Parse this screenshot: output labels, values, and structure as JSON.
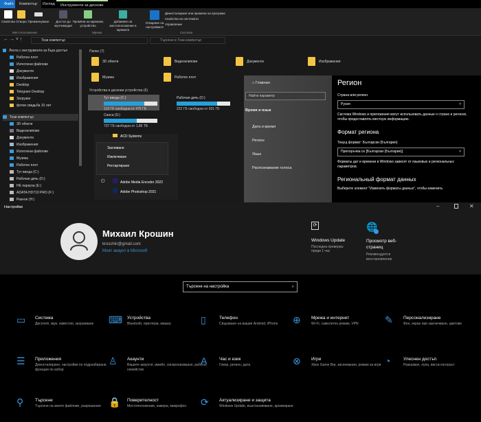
{
  "explorer": {
    "tabs": [
      "Файл",
      "Компютър",
      "Изглед",
      "Инструменти за дискове"
    ],
    "ribbon": {
      "buttons": [
        "Свойства",
        "Отвори",
        "Преименуване",
        "Достъп до мултимедия",
        "Промяна на мрежово устройство",
        "Добавяне на местоположение в мрежата",
        "Отваряне на настройките"
      ],
      "system_links": [
        "Деинсталиране или промяна на програма",
        "Свойства на системата",
        "Управление"
      ],
      "groups": [
        "Местоположение",
        "Мрежа",
        "Система"
      ]
    },
    "address": "Този компютър",
    "search_placeholder": "Търсене в Този компютър",
    "nav": {
      "quick_access": "Лента с инструменти за бърз достъп",
      "quick_items": [
        "Работен плот",
        "Изтеглени файлове",
        "Документи",
        "Изображения",
        "Desktop",
        "Telegram Desktop",
        "Загрузки",
        "фотки свадьба 10 лет"
      ],
      "this_pc": "Този компютър",
      "pc_items": [
        "3D обекти",
        "Видеоклипове",
        "Документи",
        "Изображения",
        "Изтеглени файлове",
        "Музика",
        "Работен плот",
        "Тут винда (C:)",
        "Рабочая дичь (D:)",
        "НЕ паркуха (E:)",
        "ADATA HD710 PRO (F:)",
        "Разное (H:)"
      ]
    },
    "folders_header": "Папки (7)",
    "folders": [
      "3D обекти",
      "Видеоклипове",
      "Документи",
      "Изображения",
      "Музика",
      "Работен плот"
    ],
    "drives_header": "Устройства и дискови устройства (6)",
    "drives": [
      {
        "name": "Тут винда (C:)",
        "free": "118 ГБ свободни от 475 ГБ",
        "used_pct": 75
      },
      {
        "name": "Рабочая дичь (D:)",
        "free": "222 ГБ свободни от 931 ГБ",
        "used_pct": 76
      },
      {
        "name": "Санса (S:)",
        "free": "737 ГБ свободни от 1,86 ТБ",
        "used_pct": 61
      }
    ]
  },
  "start_menu": {
    "folder": "ACD Systems",
    "power": [
      "Заспиване",
      "Изключване",
      "Рестартиране"
    ],
    "apps": [
      "Adobe Media Encoder 2022",
      "Adobe Photoshop 2021"
    ]
  },
  "region_settings": {
    "nav": {
      "home": "Главная",
      "search_placeholder": "Найти параметр",
      "section": "Время и язык",
      "items": [
        "Дата и время",
        "Регион",
        "Язык",
        "Распознавание голоса"
      ]
    },
    "title": "Регион",
    "country_label": "Страна или регион",
    "country_value": "Русия",
    "country_desc": "Система Windows и приложения могут использовать данные о стране и регионе, чтобы предоставлять местную информацию.",
    "format_title": "Формат региона",
    "current_format": "Текущ формат: Български (България)",
    "format_value": "Препоръчва се [Български (България)]",
    "format_desc": "Форматы дат и времени в Windows зависят от языковых и региональных параметров.",
    "data_title": "Региональный формат данных",
    "data_desc": "Выберите элемент \"Изменить форматы данных\", чтобы изменить"
  },
  "settings": {
    "title": "Настройки",
    "user": {
      "name": "Михаил Крошин",
      "email": "kroschin@gmail.com",
      "link": "Моят акаунт в Microsoft"
    },
    "tiles": [
      {
        "title": "Windows Update",
        "desc": "Последна проверка: преди 1 час"
      },
      {
        "title": "Просмотр веб-страниц",
        "desc": "Рекомендуется восстановление"
      }
    ],
    "search_placeholder": "Търсене на настройка",
    "accent": "#3a96dd",
    "categories": [
      {
        "title": "Система",
        "desc": "Дисплей, звук, известия, захранване"
      },
      {
        "title": "Устройства",
        "desc": "Bluetooth, принтери, мишка"
      },
      {
        "title": "Телефон",
        "desc": "Свързване на вашия Android, iPhone"
      },
      {
        "title": "Мрежа и интернет",
        "desc": "Wi-Fi, самолетен режим, VPN"
      },
      {
        "title": "Персонализиране",
        "desc": "Фон, екран при заключване, цветове"
      },
      {
        "title": "Приложения",
        "desc": "Деинсталиране, настройки по подразбиране, функции по избор"
      },
      {
        "title": "Акаунти",
        "desc": "Вашите акаунти, имейл, синхронизиране, работа, семейство"
      },
      {
        "title": "Час и език",
        "desc": "Говор, регион, дата"
      },
      {
        "title": "Игри",
        "desc": "Xbox Game Bar, заснемания, режим за игри"
      },
      {
        "title": "Улеснен достъп",
        "desc": "Разказвач, лупа, висок контраст"
      },
      {
        "title": "Търсене",
        "desc": "Търсене на моите файлове, разрешения"
      },
      {
        "title": "Поверителност",
        "desc": "Местоположение, камера, микрофон"
      },
      {
        "title": "Актуализиране и защита",
        "desc": "Windows Update, възстановяване, архивиране"
      }
    ]
  }
}
